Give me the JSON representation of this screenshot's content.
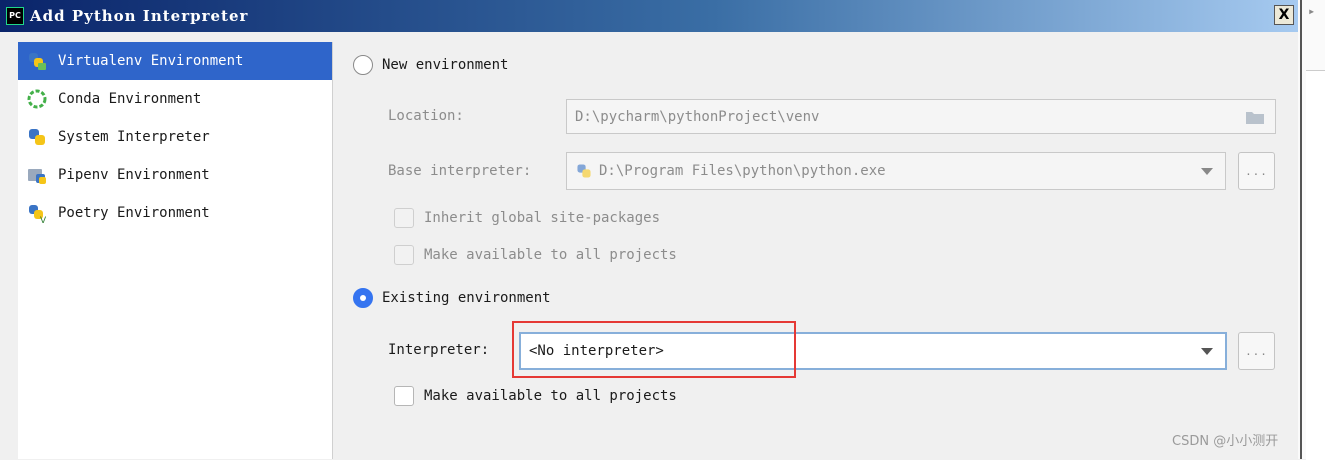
{
  "window": {
    "title": "Add Python Interpreter",
    "close_label": "X",
    "app_icon_text": "PC"
  },
  "sidebar": {
    "items": [
      {
        "label": "Virtualenv Environment",
        "icon": "virtualenv-icon"
      },
      {
        "label": "Conda Environment",
        "icon": "conda-icon"
      },
      {
        "label": "System Interpreter",
        "icon": "python-icon"
      },
      {
        "label": "Pipenv Environment",
        "icon": "pipenv-icon"
      },
      {
        "label": "Poetry Environment",
        "icon": "poetry-icon"
      }
    ]
  },
  "new_env": {
    "label": "New environment",
    "location_label": "Location:",
    "location_value": "D:\\pycharm\\pythonProject\\venv",
    "base_label": "Base interpreter:",
    "base_value": "D:\\Program Files\\python\\python.exe",
    "inherit_label": "Inherit global site-packages",
    "make_available_label": "Make available to all projects"
  },
  "existing_env": {
    "label": "Existing environment",
    "interpreter_label": "Interpreter:",
    "interpreter_value": "<No interpreter>",
    "make_available_label": "Make available to all projects"
  },
  "browse_label": "...",
  "watermark": "CSDN @小小测开",
  "colors": {
    "selected": "#2f65ca",
    "accent": "#3574f0",
    "highlight": "#e53935",
    "titlebar": "#0a246a"
  }
}
